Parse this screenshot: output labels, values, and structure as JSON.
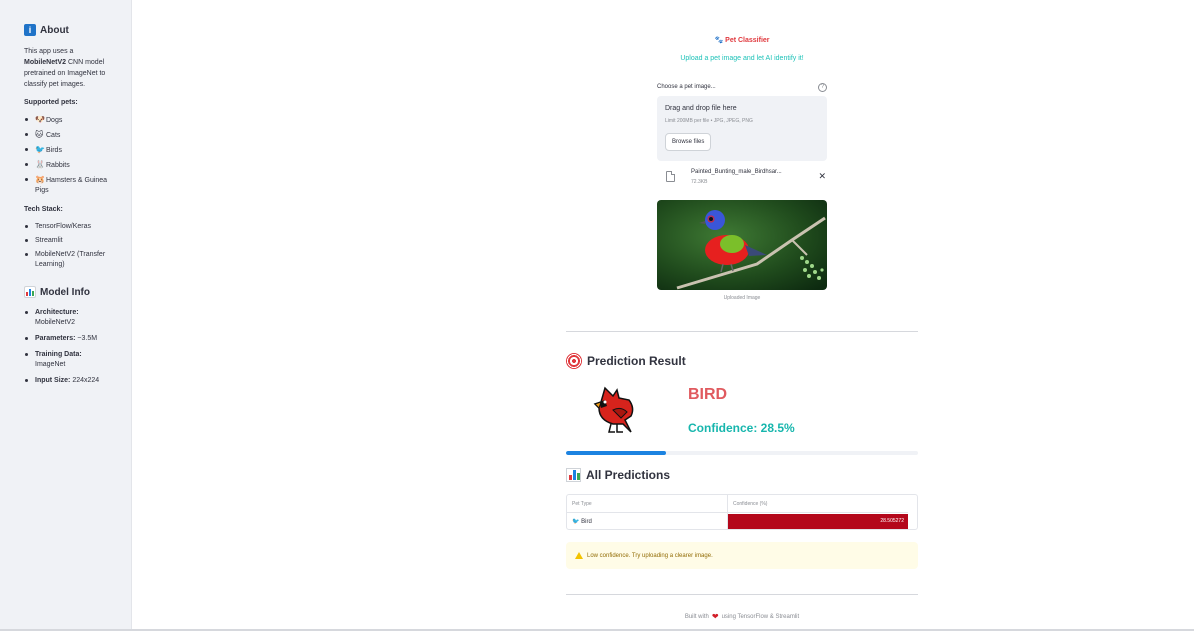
{
  "sidebar": {
    "about_title": "About",
    "about_text_pre": "This app uses a",
    "about_text_bold": "MobileNetV2",
    "about_text_post": "CNN model pretrained on ImageNet to classify pet images.",
    "supported_label": "Supported pets:",
    "pets": [
      {
        "icon": "🐶",
        "label": "Dogs"
      },
      {
        "icon": "🐱",
        "label": "Cats"
      },
      {
        "icon": "🐦",
        "label": "Birds"
      },
      {
        "icon": "🐰",
        "label": "Rabbits"
      },
      {
        "icon": "🐹",
        "label": "Hamsters & Guinea Pigs"
      }
    ],
    "tech_label": "Tech Stack:",
    "tech": [
      "TensorFlow/Keras",
      "Streamlit",
      "MobileNetV2 (Transfer Learning)"
    ],
    "model_title": "Model Info",
    "model_info": [
      {
        "key": "Architecture:",
        "value": "MobileNetV2"
      },
      {
        "key": "Parameters:",
        "value": "~3.5M"
      },
      {
        "key": "Training Data:",
        "value": "ImageNet"
      },
      {
        "key": "Input Size:",
        "value": "224x224"
      }
    ]
  },
  "main": {
    "title": "Pet Classifier",
    "subtitle": "Upload a pet image and let AI identify it!",
    "uploader": {
      "label": "Choose a pet image...",
      "drop_text": "Drag and drop file here",
      "limit_text": "Limit 200MB per file • JPG, JPEG, PNG",
      "browse_label": "Browse files",
      "file_name": "Painted_Bunting_male_Birdhsar...",
      "file_size": "72.3KB"
    },
    "image_caption": "Uploaded Image",
    "result_title": "Prediction Result",
    "prediction": "BIRD",
    "confidence_text": "Confidence: 28.5%",
    "confidence_fraction": 0.285,
    "all_title": "All Predictions",
    "table": {
      "headers": [
        "Pet Type",
        "Confidence (%)"
      ],
      "rows": [
        {
          "type": "🐦 Bird",
          "confidence": "28.505272",
          "fraction": 0.285
        }
      ]
    },
    "warning": "Low confidence. Try uploading a clearer image.",
    "footer_pre": "Built with",
    "footer_post": "using TensorFlow & Streamlit"
  },
  "colors": {
    "title": "#e0393e",
    "subtitle": "#1ec2b8",
    "prediction": "#e05a5f",
    "confidence": "#17b6ad",
    "progress": "#1c83e1",
    "table_bar": "#b4071b",
    "warning_bg": "#fffce7"
  }
}
